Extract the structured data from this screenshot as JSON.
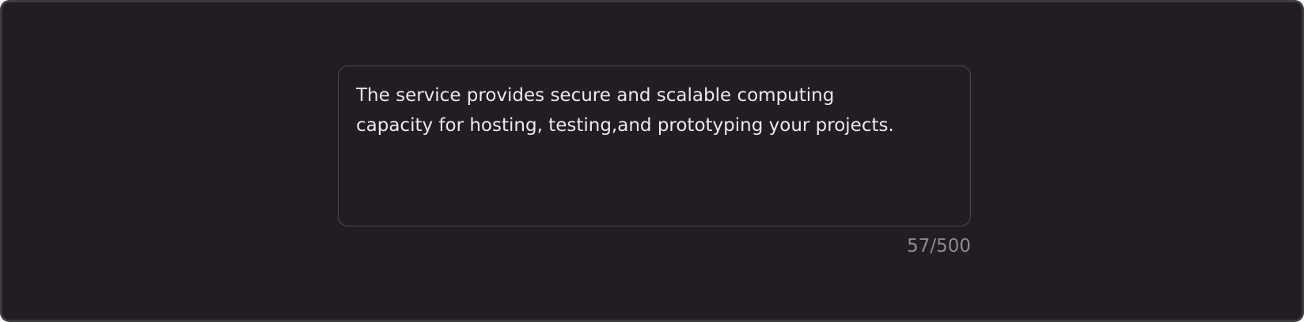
{
  "textarea": {
    "value": "The service provides secure and scalable computing\ncapacity for hosting, testing,and prototyping your projects."
  },
  "counter": {
    "text": "57/500"
  },
  "colors": {
    "background": "#241c25",
    "frame_border": "#3f3a41",
    "field_border": "#4d474f",
    "text": "#ece9ec",
    "counter_text": "#8e8990"
  }
}
